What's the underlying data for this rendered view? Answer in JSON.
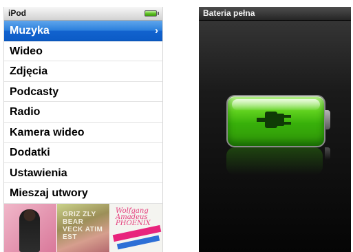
{
  "left_screen": {
    "title": "iPod",
    "battery_icon": "battery-full-icon",
    "menu": [
      {
        "label": "Muzyka",
        "selected": true
      },
      {
        "label": "Wideo",
        "selected": false
      },
      {
        "label": "Zdjęcia",
        "selected": false
      },
      {
        "label": "Podcasty",
        "selected": false
      },
      {
        "label": "Radio",
        "selected": false
      },
      {
        "label": "Kamera wideo",
        "selected": false
      },
      {
        "label": "Dodatki",
        "selected": false
      },
      {
        "label": "Ustawienia",
        "selected": false
      },
      {
        "label": "Mieszaj utwory",
        "selected": false
      }
    ],
    "chevron": "›",
    "album_covers": {
      "cover_2_text": "GRIZ ZLY BEAR VECK ATIM EST",
      "cover_3_text": "Wolfgang Amadeus PHOENIX"
    }
  },
  "right_screen": {
    "title": "Bateria pełna",
    "battery_level": 1.0,
    "icon": "plug-icon"
  },
  "colors": {
    "selection_blue": "#2a7fdc",
    "battery_green": "#38b00a"
  }
}
